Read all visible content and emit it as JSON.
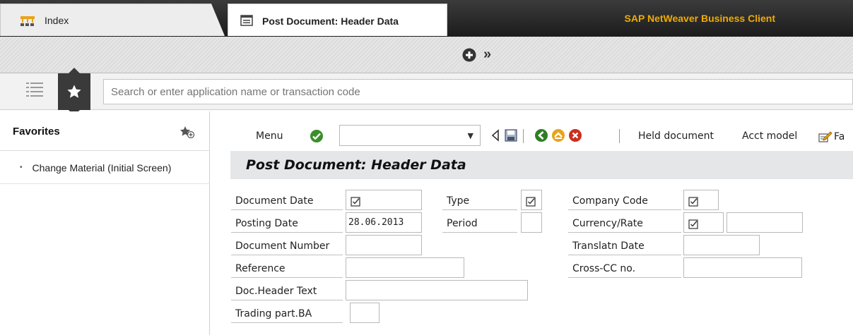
{
  "titlebar": {
    "app_title": "SAP NetWeaver Business Client"
  },
  "tabs": {
    "index_label": "Index",
    "active_label": "Post Document: Header Data"
  },
  "search": {
    "placeholder": "Search or enter application name or transaction code"
  },
  "sidebar": {
    "title": "Favorites",
    "items": [
      {
        "label": "Change Material (Initial Screen)"
      }
    ]
  },
  "toolbar": {
    "menu_label": "Menu",
    "held_document_label": "Held document",
    "acct_model_label": "Acct model",
    "fast_data_label": "Fa"
  },
  "screen": {
    "title": "Post Document: Header Data"
  },
  "form": {
    "document_date": {
      "label": "Document Date",
      "value": ""
    },
    "posting_date": {
      "label": "Posting Date",
      "value": "28.06.2013"
    },
    "document_number": {
      "label": "Document Number",
      "value": ""
    },
    "reference": {
      "label": "Reference",
      "value": ""
    },
    "doc_header_text": {
      "label": "Doc.Header Text",
      "value": ""
    },
    "trading_part_ba": {
      "label": "Trading part.BA",
      "value": ""
    },
    "type": {
      "label": "Type",
      "value": ""
    },
    "period": {
      "label": "Period",
      "value": ""
    },
    "company_code": {
      "label": "Company Code",
      "value": ""
    },
    "currency_rate": {
      "label": "Currency/Rate",
      "value": "",
      "rate_value": ""
    },
    "translatn_date": {
      "label": "Translatn Date",
      "value": ""
    },
    "cross_cc_no": {
      "label": "Cross-CC no.",
      "value": ""
    }
  },
  "colors": {
    "titlebar_bg": "#2a2a2a",
    "app_title": "#f0ab00",
    "confirm_green": "#3a8f2a",
    "exit_orange": "#e8a317",
    "cancel_red": "#cc2e1e"
  }
}
